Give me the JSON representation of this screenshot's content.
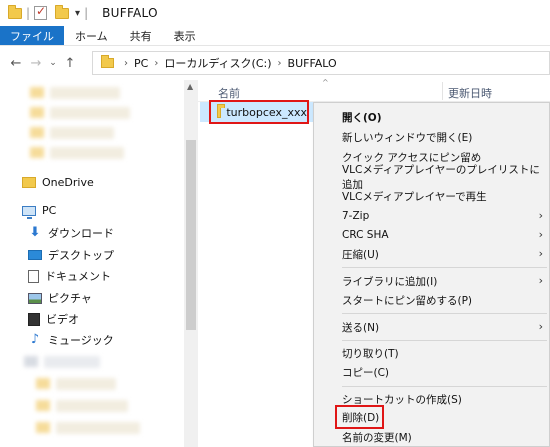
{
  "window": {
    "title": "BUFFALO",
    "dropdown_arrow": "▾"
  },
  "ribbon": {
    "tabs": [
      "ファイル",
      "ホーム",
      "共有",
      "表示"
    ]
  },
  "navigation": {
    "back": "←",
    "forward": "→",
    "recent": "⌄",
    "up": "↑",
    "breadcrumb": [
      "PC",
      "ローカルディスク(C:)",
      "BUFFALO"
    ],
    "crumb_separator": "›"
  },
  "nav_pane": {
    "items": [
      {
        "label": "OneDrive",
        "icon": "folder-icon"
      },
      {
        "label": "PC",
        "icon": "pc-icon"
      },
      {
        "label": "ダウンロード",
        "icon": "download-icon"
      },
      {
        "label": "デスクトップ",
        "icon": "desktop-icon"
      },
      {
        "label": "ドキュメント",
        "icon": "document-icon"
      },
      {
        "label": "ピクチャ",
        "icon": "pictures-icon"
      },
      {
        "label": "ビデオ",
        "icon": "video-icon"
      },
      {
        "label": "ミュージック",
        "icon": "music-icon"
      }
    ]
  },
  "file_list": {
    "columns": [
      "名前",
      "更新日時"
    ],
    "sort_caret": "^",
    "items": [
      {
        "name": "turbopcex_xxx",
        "icon": "folder-icon",
        "selected": true
      }
    ]
  },
  "context_menu": {
    "items": [
      {
        "label": "開く(O)",
        "bold": true
      },
      {
        "label": "新しいウィンドウで開く(E)"
      },
      {
        "label": "クイック アクセスにピン留め"
      },
      {
        "label": "VLCメディアプレイヤーのプレイリストに追加"
      },
      {
        "label": "VLCメディアプレイヤーで再生"
      },
      {
        "label": "7-Zip",
        "submenu": true
      },
      {
        "label": "CRC SHA",
        "submenu": true
      },
      {
        "label": "圧縮(U)",
        "submenu": true
      },
      {
        "separator": true
      },
      {
        "label": "ライブラリに追加(I)",
        "submenu": true
      },
      {
        "label": "スタートにピン留めする(P)"
      },
      {
        "separator": true
      },
      {
        "label": "送る(N)",
        "submenu": true
      },
      {
        "separator": true
      },
      {
        "label": "切り取り(T)"
      },
      {
        "label": "コピー(C)"
      },
      {
        "separator": true
      },
      {
        "label": "ショートカットの作成(S)"
      },
      {
        "label": "削除(D)",
        "highlighted": true
      },
      {
        "label": "名前の変更(M)"
      }
    ],
    "submenu_arrow": "›"
  },
  "colors": {
    "accent": "#1a73c8",
    "selection": "#cce8ff",
    "highlight_box": "#e01616",
    "folder": "#f2c94c"
  }
}
